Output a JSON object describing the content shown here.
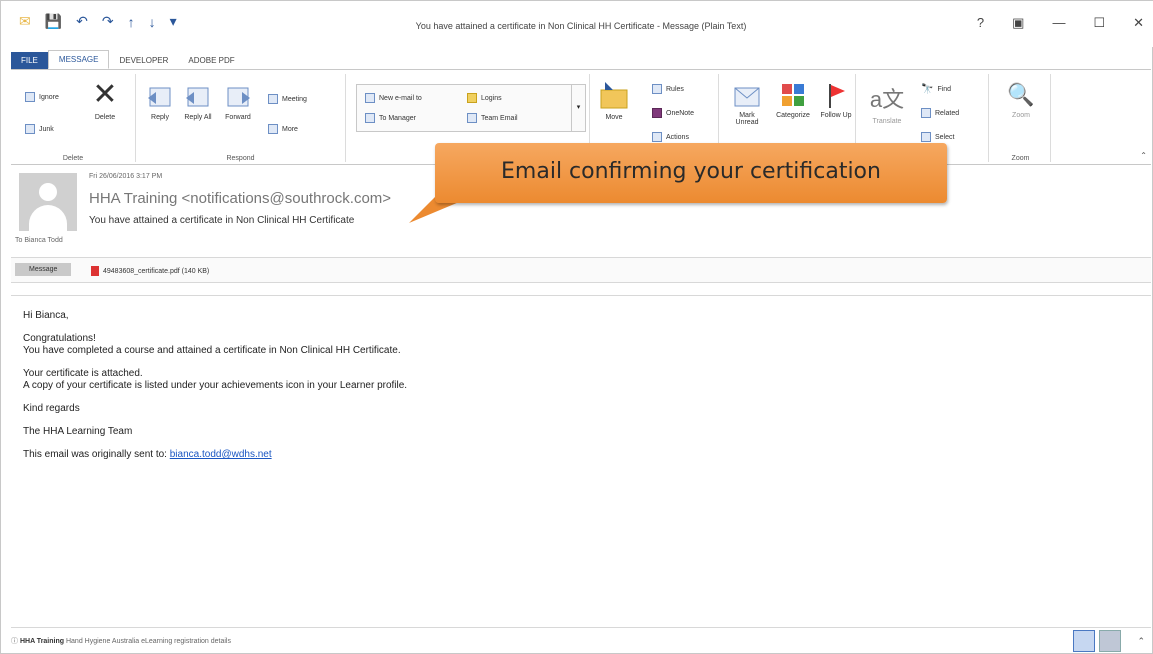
{
  "window": {
    "title": "You have attained a certificate in Non Clinical HH Certificate - Message (Plain Text)",
    "controls": [
      "?",
      "▣",
      "—",
      "☐",
      "✕"
    ]
  },
  "tabs": [
    "FILE",
    "MESSAGE",
    "DEVELOPER",
    "ADOBE PDF"
  ],
  "ribbon": {
    "delete_group": {
      "label": "Delete",
      "ignore": "Ignore",
      "junk": "Junk",
      "delete": "Delete"
    },
    "respond_group": {
      "label": "Respond",
      "reply": "Reply",
      "reply_all": "Reply All",
      "forward": "Forward",
      "meeting": "Meeting",
      "more": "More"
    },
    "quicksteps": {
      "new_email_to": "New e-mail to",
      "to_manager": "To Manager",
      "logins": "Logins",
      "team_email": "Team Email"
    },
    "move_group": {
      "move": "Move",
      "rules": "Rules",
      "onenote": "OneNote",
      "actions": "Actions"
    },
    "tags_group": {
      "mark_unread": "Mark Unread",
      "categorize": "Categorize",
      "follow_up": "Follow Up"
    },
    "editing_group": {
      "translate": "Translate",
      "find": "Find",
      "related": "Related",
      "select": "Select"
    },
    "zoom_group": {
      "label": "Zoom",
      "zoom": "Zoom"
    }
  },
  "message": {
    "date": "Fri 26/06/2016 3:17 PM",
    "sender": "HHA Training <notifications@southrock.com>",
    "subject": "You have attained a certificate in Non Clinical HH Certificate",
    "to": "To   Bianca Todd"
  },
  "callout": {
    "text": "Email confirming your certification"
  },
  "attachments": {
    "message_tab": "Message",
    "file": "49483608_certificate.pdf (140 KB)"
  },
  "body": {
    "greeting": "Hi Bianca,",
    "congrats": "Congratulations!",
    "completed": "You have completed a course and attained a certificate in Non Clinical HH Certificate.",
    "attached": "Your certificate is attached.",
    "copy": "A copy of your certificate is listed under your achievements icon in your Learner profile.",
    "regards": "Kind regards",
    "team": "The HHA Learning Team",
    "sent_to_label": "This email was originally sent to:",
    "sent_to_email": "bianca.todd@wdhs.net"
  },
  "statusbar": {
    "sender": "HHA Training",
    "text": "Hand Hygiene Australia eLearning registration details"
  }
}
